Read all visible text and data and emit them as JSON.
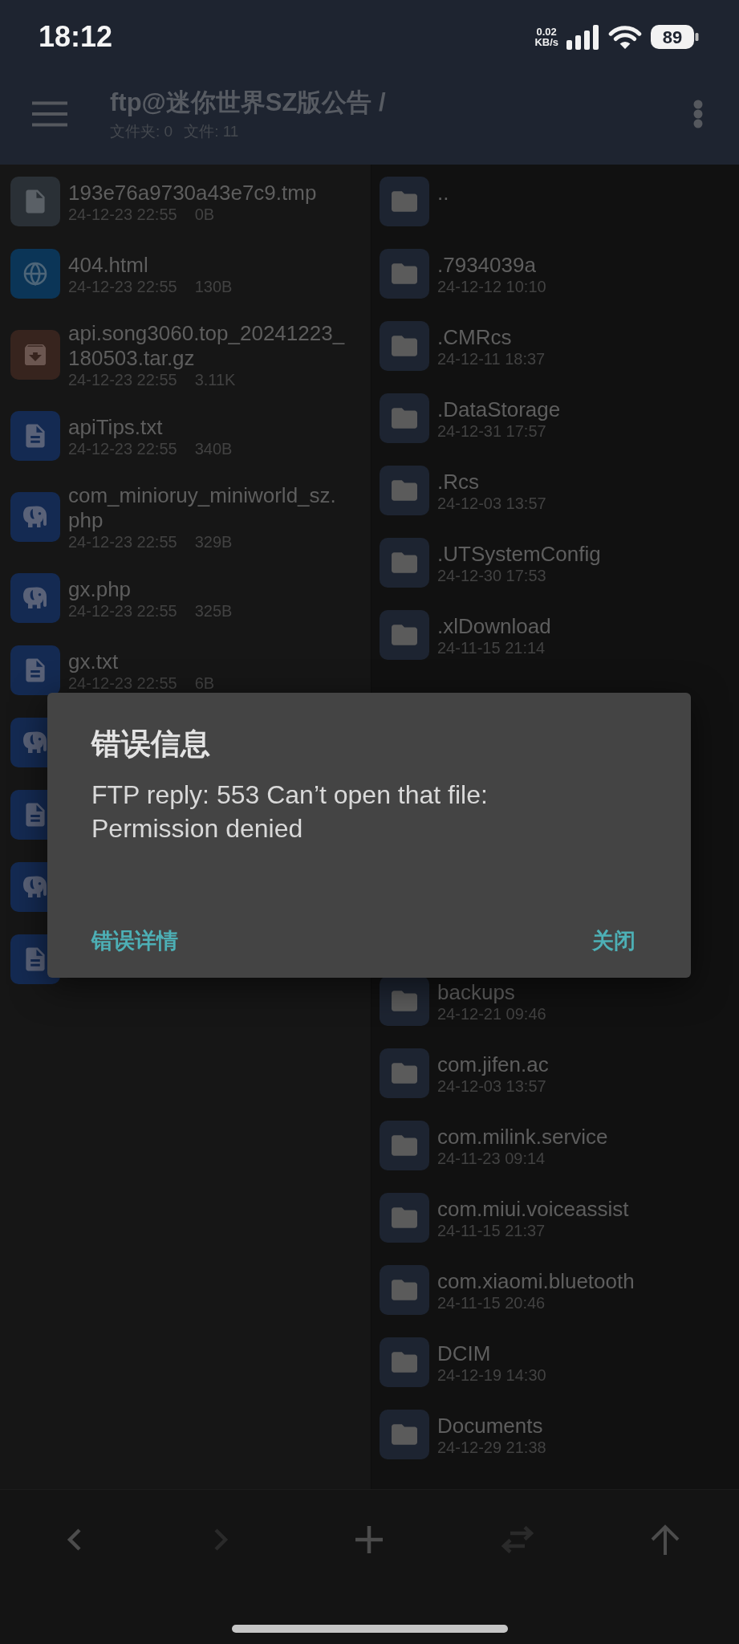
{
  "status_bar": {
    "time": "18:12",
    "network_speed": {
      "value": "0.02",
      "unit": "KB/s"
    },
    "battery": "89"
  },
  "header": {
    "title": "ftp@迷你世界SZ版公告 /",
    "folder_count": "文件夹: 0",
    "file_count": "文件: 11"
  },
  "left_pane": {
    "items": [
      {
        "kind": "tmp",
        "name": "193e76a9730a43e7c9.tmp",
        "date": "24-12-23 22:55",
        "size": "0B"
      },
      {
        "kind": "html",
        "name": "404.html",
        "date": "24-12-23 22:55",
        "size": "130B"
      },
      {
        "kind": "archive",
        "name": "api.song3060.top_20241223_180503.tar.gz",
        "date": "24-12-23 22:55",
        "size": "3.11K"
      },
      {
        "kind": "txt",
        "name": "apiTips.txt",
        "date": "24-12-23 22:55",
        "size": "340B"
      },
      {
        "kind": "php",
        "name": "com_minioruy_miniworld_sz.php",
        "date": "24-12-23 22:55",
        "size": "329B"
      },
      {
        "kind": "php",
        "name": "gx.php",
        "date": "24-12-23 22:55",
        "size": "325B"
      },
      {
        "kind": "txt",
        "name": "gx.txt",
        "date": "24-12-23 22:55",
        "size": "6B"
      },
      {
        "kind": "php"
      },
      {
        "kind": "txt"
      },
      {
        "kind": "php"
      },
      {
        "kind": "txt"
      }
    ]
  },
  "right_pane": {
    "folders_above_dialog": [
      {
        "name": ".."
      },
      {
        "name": ".7934039a",
        "date": "24-12-12 10:10"
      },
      {
        "name": ".CMRcs",
        "date": "24-12-11 18:37"
      },
      {
        "name": ".DataStorage",
        "date": "24-12-31 17:57"
      },
      {
        "name": ".Rcs",
        "date": "24-12-03 13:57"
      },
      {
        "name": ".UTSystemConfig",
        "date": "24-12-30 17:53"
      },
      {
        "name": ".xlDownload",
        "date": "24-11-15 21:14"
      }
    ],
    "folders_below_dialog": [
      {
        "name": "backups",
        "date": "24-12-21 09:46"
      },
      {
        "name": "com.jifen.ac",
        "date": "24-12-03 13:57"
      },
      {
        "name": "com.milink.service",
        "date": "24-11-23 09:14"
      },
      {
        "name": "com.miui.voiceassist",
        "date": "24-11-15 21:37"
      },
      {
        "name": "com.xiaomi.bluetooth",
        "date": "24-11-15 20:46"
      },
      {
        "name": "DCIM",
        "date": "24-12-19 14:30"
      },
      {
        "name": "Documents",
        "date": "24-12-29 21:38"
      }
    ]
  },
  "dialog": {
    "title": "错误信息",
    "message": "FTP reply: 553 Can’t open that file: Permission denied",
    "buttons": [
      {
        "label": "错误详情"
      },
      {
        "label": "关闭"
      }
    ]
  },
  "bottom_bar": {
    "buttons": [
      {
        "kind": "back",
        "disabled": false
      },
      {
        "kind": "forward",
        "disabled": true
      },
      {
        "kind": "add",
        "disabled": false
      },
      {
        "kind": "swap",
        "disabled": true
      },
      {
        "kind": "up",
        "disabled": false
      }
    ]
  }
}
